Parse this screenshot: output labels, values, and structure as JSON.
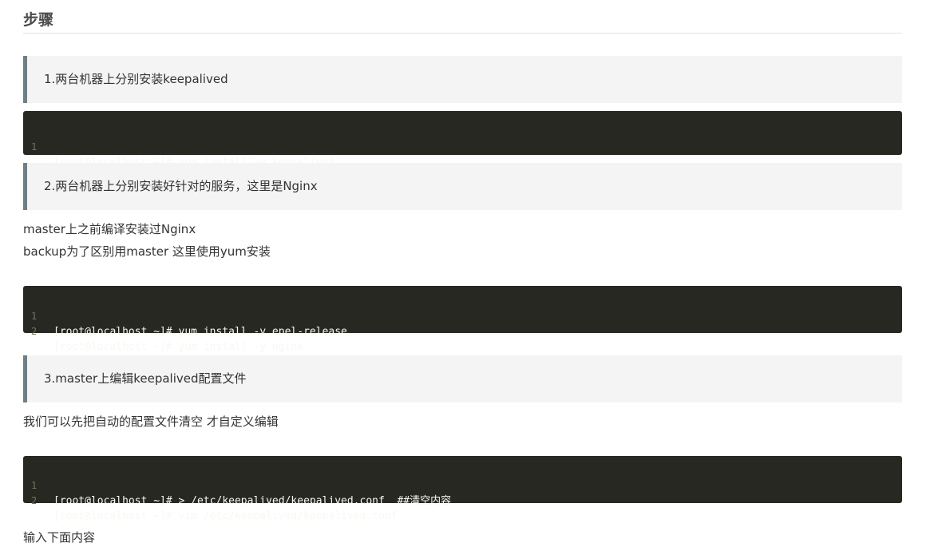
{
  "heading": "步骤",
  "steps": [
    {
      "title": "1.两台机器上分别安装keepalived",
      "code": [
        {
          "no": "1",
          "text": "[root@localhost ~]# yum install -y keepalived"
        }
      ]
    },
    {
      "title": "2.两台机器上分别安装好针对的服务，这里是Nginx",
      "paragraphs": [
        "master上之前编译安装过Nginx",
        "backup为了区别用master 这里使用yum安装"
      ],
      "code": [
        {
          "no": "1",
          "text": "[root@localhost ~]# yum install -y epel-release"
        },
        {
          "no": "2",
          "text": "[root@localhost ~]# yum install -y nginx"
        }
      ]
    },
    {
      "title": "3.master上编辑keepalived配置文件",
      "paragraphs": [
        "我们可以先把自动的配置文件清空 才自定义编辑"
      ],
      "code": [
        {
          "no": "1",
          "text": "[root@localhost ~]# > /etc/keepalived/keepalived.conf  ##清空内容"
        },
        {
          "no": "2",
          "text": "[root@localhost ~]# vim /etc/keepalived/keepalived.conf"
        }
      ],
      "after": "输入下面内容"
    }
  ],
  "colors": {
    "note_background": "#f4f4f4",
    "note_border": "#6f7f86",
    "code_background": "#272822",
    "code_text": "#f8f8f2",
    "line_number": "#75715e"
  }
}
